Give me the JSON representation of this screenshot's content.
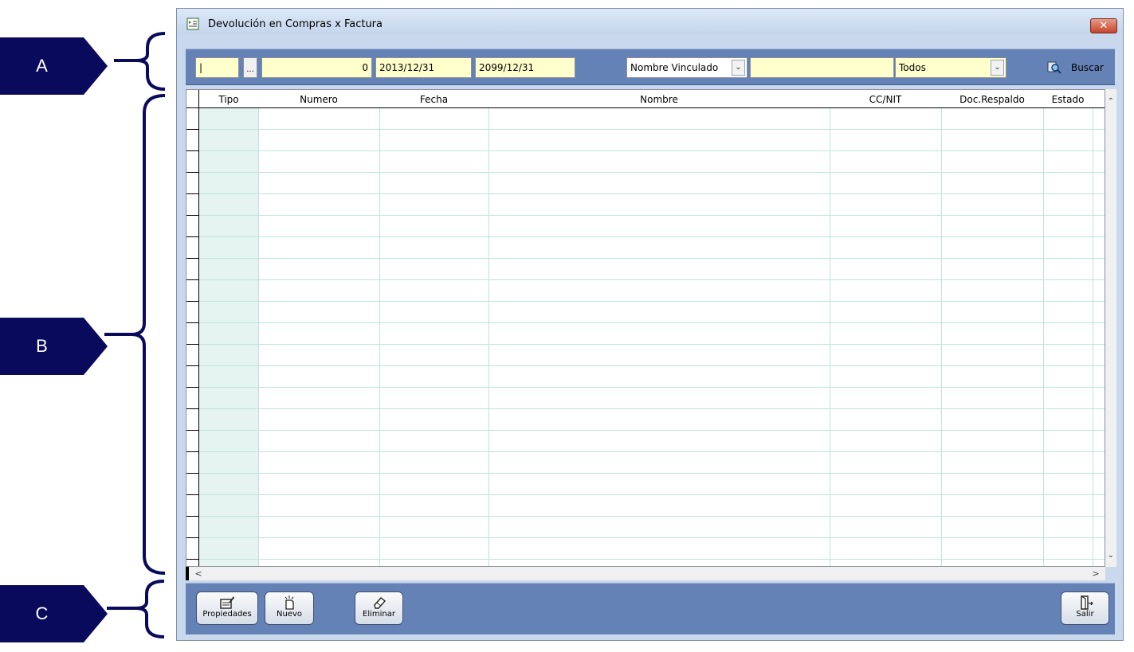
{
  "annotations": {
    "a": "A",
    "b": "B",
    "c": "C"
  },
  "window": {
    "title": "Devolución en Compras x Factura",
    "close": "✕"
  },
  "filters": {
    "code": "|",
    "dots": "...",
    "number": "0",
    "date_from": "2013/12/31",
    "date_to": "2099/12/31",
    "search_by": "Nombre Vinculado",
    "search_text": "",
    "status": "Todos",
    "buscar": "Buscar"
  },
  "grid": {
    "columns": [
      "Tipo",
      "Numero",
      "Fecha",
      "Nombre",
      "CC/NIT",
      "Doc.Respaldo",
      "Estado"
    ]
  },
  "buttons": {
    "propiedades": "Propiedades",
    "nuevo": "Nuevo",
    "eliminar": "Eliminar",
    "salir": "Salir"
  },
  "colors": {
    "toolbar": "#6582b7",
    "field": "#ffffcc",
    "annotation": "#0a0a5c"
  }
}
